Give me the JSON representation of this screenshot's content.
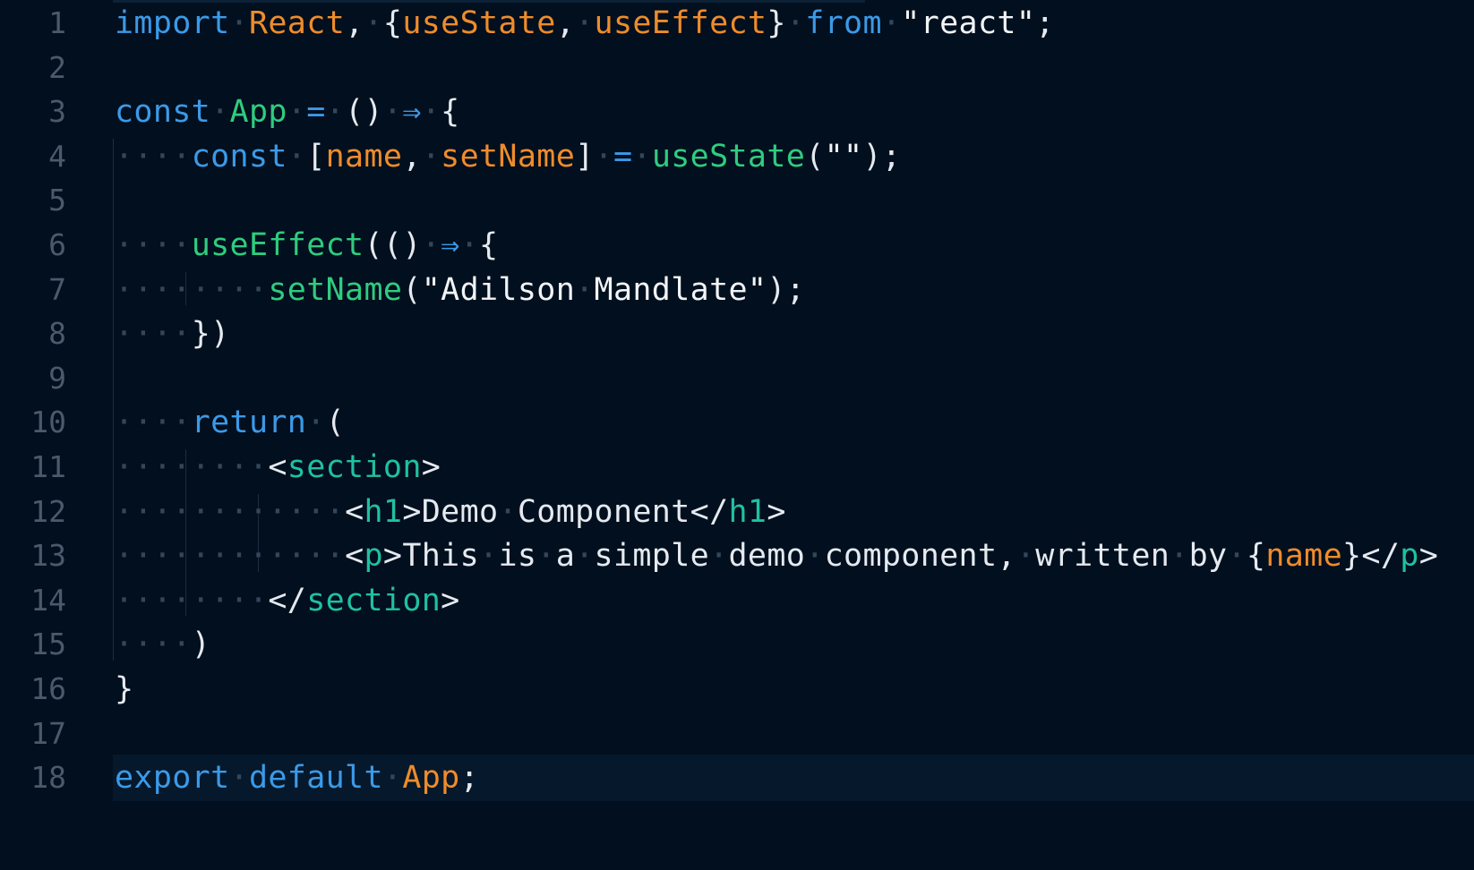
{
  "editor": {
    "language": "javascript",
    "current_line": 18,
    "whitespace_glyph": "·",
    "colors": {
      "background": "#020f1e",
      "line_number": "#4a5a6c",
      "keyword": "#3b9ae8",
      "identifier": "#ee8c2b",
      "function": "#2fcc7f",
      "tag": "#1fc1a2",
      "text": "#e4eaf0",
      "whitespace_marker": "#34465a",
      "current_line_highlight": "#06182b"
    },
    "lines": [
      {
        "number": "1",
        "code": "import React, {useState, useEffect} from \"react\";"
      },
      {
        "number": "2",
        "code": ""
      },
      {
        "number": "3",
        "code": "const App = () ⇒ {"
      },
      {
        "number": "4",
        "code": "    const [name, setName] = useState(\"\");"
      },
      {
        "number": "5",
        "code": ""
      },
      {
        "number": "6",
        "code": "    useEffect(() ⇒ {"
      },
      {
        "number": "7",
        "code": "        setName(\"Adilson Mandlate\");"
      },
      {
        "number": "8",
        "code": "    })"
      },
      {
        "number": "9",
        "code": ""
      },
      {
        "number": "10",
        "code": "    return ("
      },
      {
        "number": "11",
        "code": "        <section>"
      },
      {
        "number": "12",
        "code": "            <h1>Demo Component</h1>"
      },
      {
        "number": "13",
        "code": "            <p>This is a simple demo component, written by {name}</p>"
      },
      {
        "number": "14",
        "code": "        </section>"
      },
      {
        "number": "15",
        "code": "    )"
      },
      {
        "number": "16",
        "code": "}"
      },
      {
        "number": "17",
        "code": ""
      },
      {
        "number": "18",
        "code": "export default App;"
      }
    ]
  }
}
